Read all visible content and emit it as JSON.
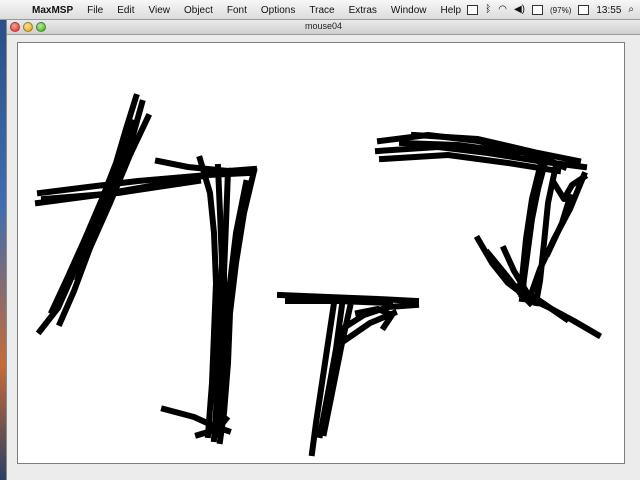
{
  "menubar": {
    "apple_glyph": "",
    "app_name": "MaxMSP",
    "items": [
      "File",
      "Edit",
      "View",
      "Object",
      "Font",
      "Options",
      "Trace",
      "Extras",
      "Window",
      "Help"
    ],
    "battery_level": "(97%)",
    "clock": "13:55",
    "status_icons": [
      "display-icon",
      "bluetooth-icon",
      "wifi-icon",
      "volume-icon",
      "battery-icon",
      "input-menu-icon",
      "spotlight-icon"
    ]
  },
  "window": {
    "title": "mouse04",
    "buttons": [
      "close",
      "minimize",
      "zoom"
    ]
  },
  "canvas": {
    "background": "#ffffff",
    "stroke_color": "#000000"
  }
}
